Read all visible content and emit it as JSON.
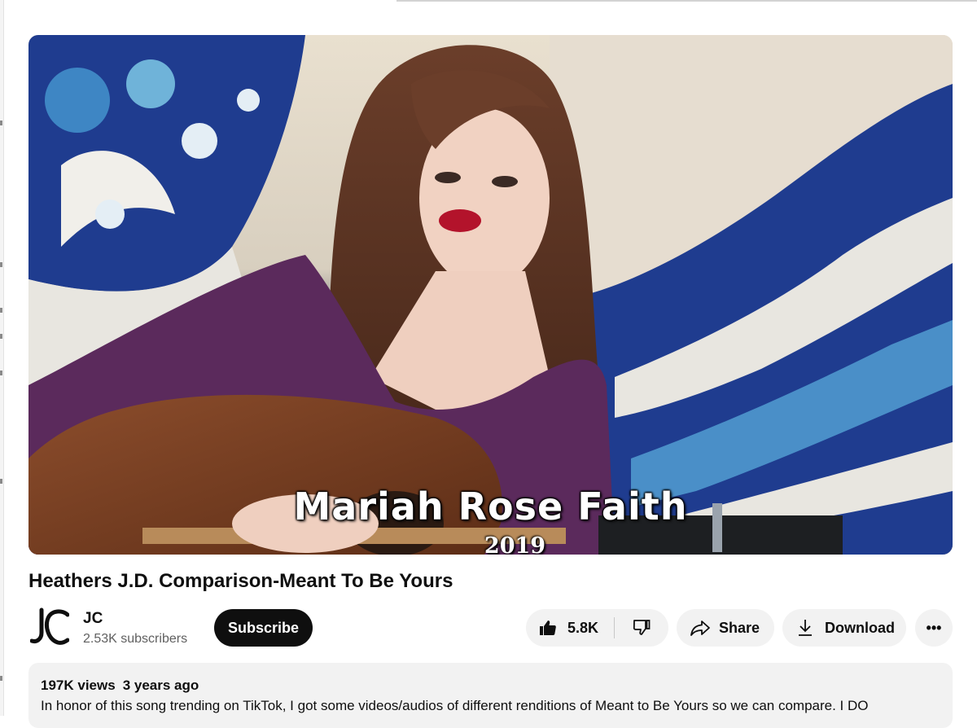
{
  "video": {
    "overlay_name": "Mariah Rose Faith",
    "overlay_year": "2019",
    "title": "Heathers J.D. Comparison-Meant To Be Yours"
  },
  "channel": {
    "name": "JC",
    "subscribers": "2.53K subscribers",
    "logo_icon": "jc-logo-icon",
    "subscribe_label": "Subscribe"
  },
  "actions": {
    "like_count": "5.8K",
    "like_icon": "thumbs-up-icon",
    "dislike_icon": "thumbs-down-icon",
    "share_label": "Share",
    "share_icon": "share-arrow-icon",
    "download_label": "Download",
    "download_icon": "download-icon",
    "more_label": "•••"
  },
  "description": {
    "views": "197K views",
    "age": "3 years ago",
    "text": "In honor of this song trending on TikTok, I got some videos/audios of different renditions of Meant to Be Yours so we can compare. I DO"
  },
  "colors": {
    "subscribe_bg": "#0f0f0f",
    "pill_bg": "#f2f2f2",
    "text_secondary": "#606060"
  }
}
